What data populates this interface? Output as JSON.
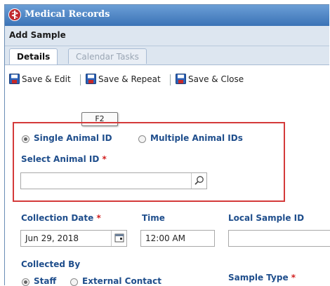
{
  "app": {
    "title": "Medical Records"
  },
  "dialog": {
    "title": "Add Sample"
  },
  "tabs": [
    {
      "label": "Details",
      "active": true
    },
    {
      "label": "Calendar Tasks",
      "active": false
    }
  ],
  "toolbar": {
    "save_edit": "Save & Edit",
    "save_repeat": "Save & Repeat",
    "save_close": "Save & Close",
    "tooltip": "F2"
  },
  "animal_selection": {
    "options": [
      {
        "label": "Single Animal ID",
        "checked": true
      },
      {
        "label": "Multiple Animal IDs",
        "checked": false
      }
    ],
    "select_label": "Select Animal ID",
    "required_mark": "*",
    "value": ""
  },
  "fields": {
    "collection_date": {
      "label": "Collection Date",
      "required_mark": "*",
      "value": "Jun 29, 2018"
    },
    "time": {
      "label": "Time",
      "value": "12:00 AM"
    },
    "local_sample_id": {
      "label": "Local Sample ID",
      "value": ""
    },
    "collected_by": {
      "label": "Collected By",
      "options": [
        {
          "label": "Staff",
          "checked": true
        },
        {
          "label": "External Contact",
          "checked": false
        }
      ]
    },
    "sample_type": {
      "label": "Sample Type",
      "required_mark": "*"
    }
  },
  "colors": {
    "title_bar": "#3b73b6",
    "label_blue": "#1f4e8c",
    "required_red": "#d21f1f",
    "highlight_red": "#d43a3a"
  },
  "icons": [
    "medical-app-icon",
    "save-disk-icon",
    "magnifier-icon",
    "calendar-icon"
  ]
}
